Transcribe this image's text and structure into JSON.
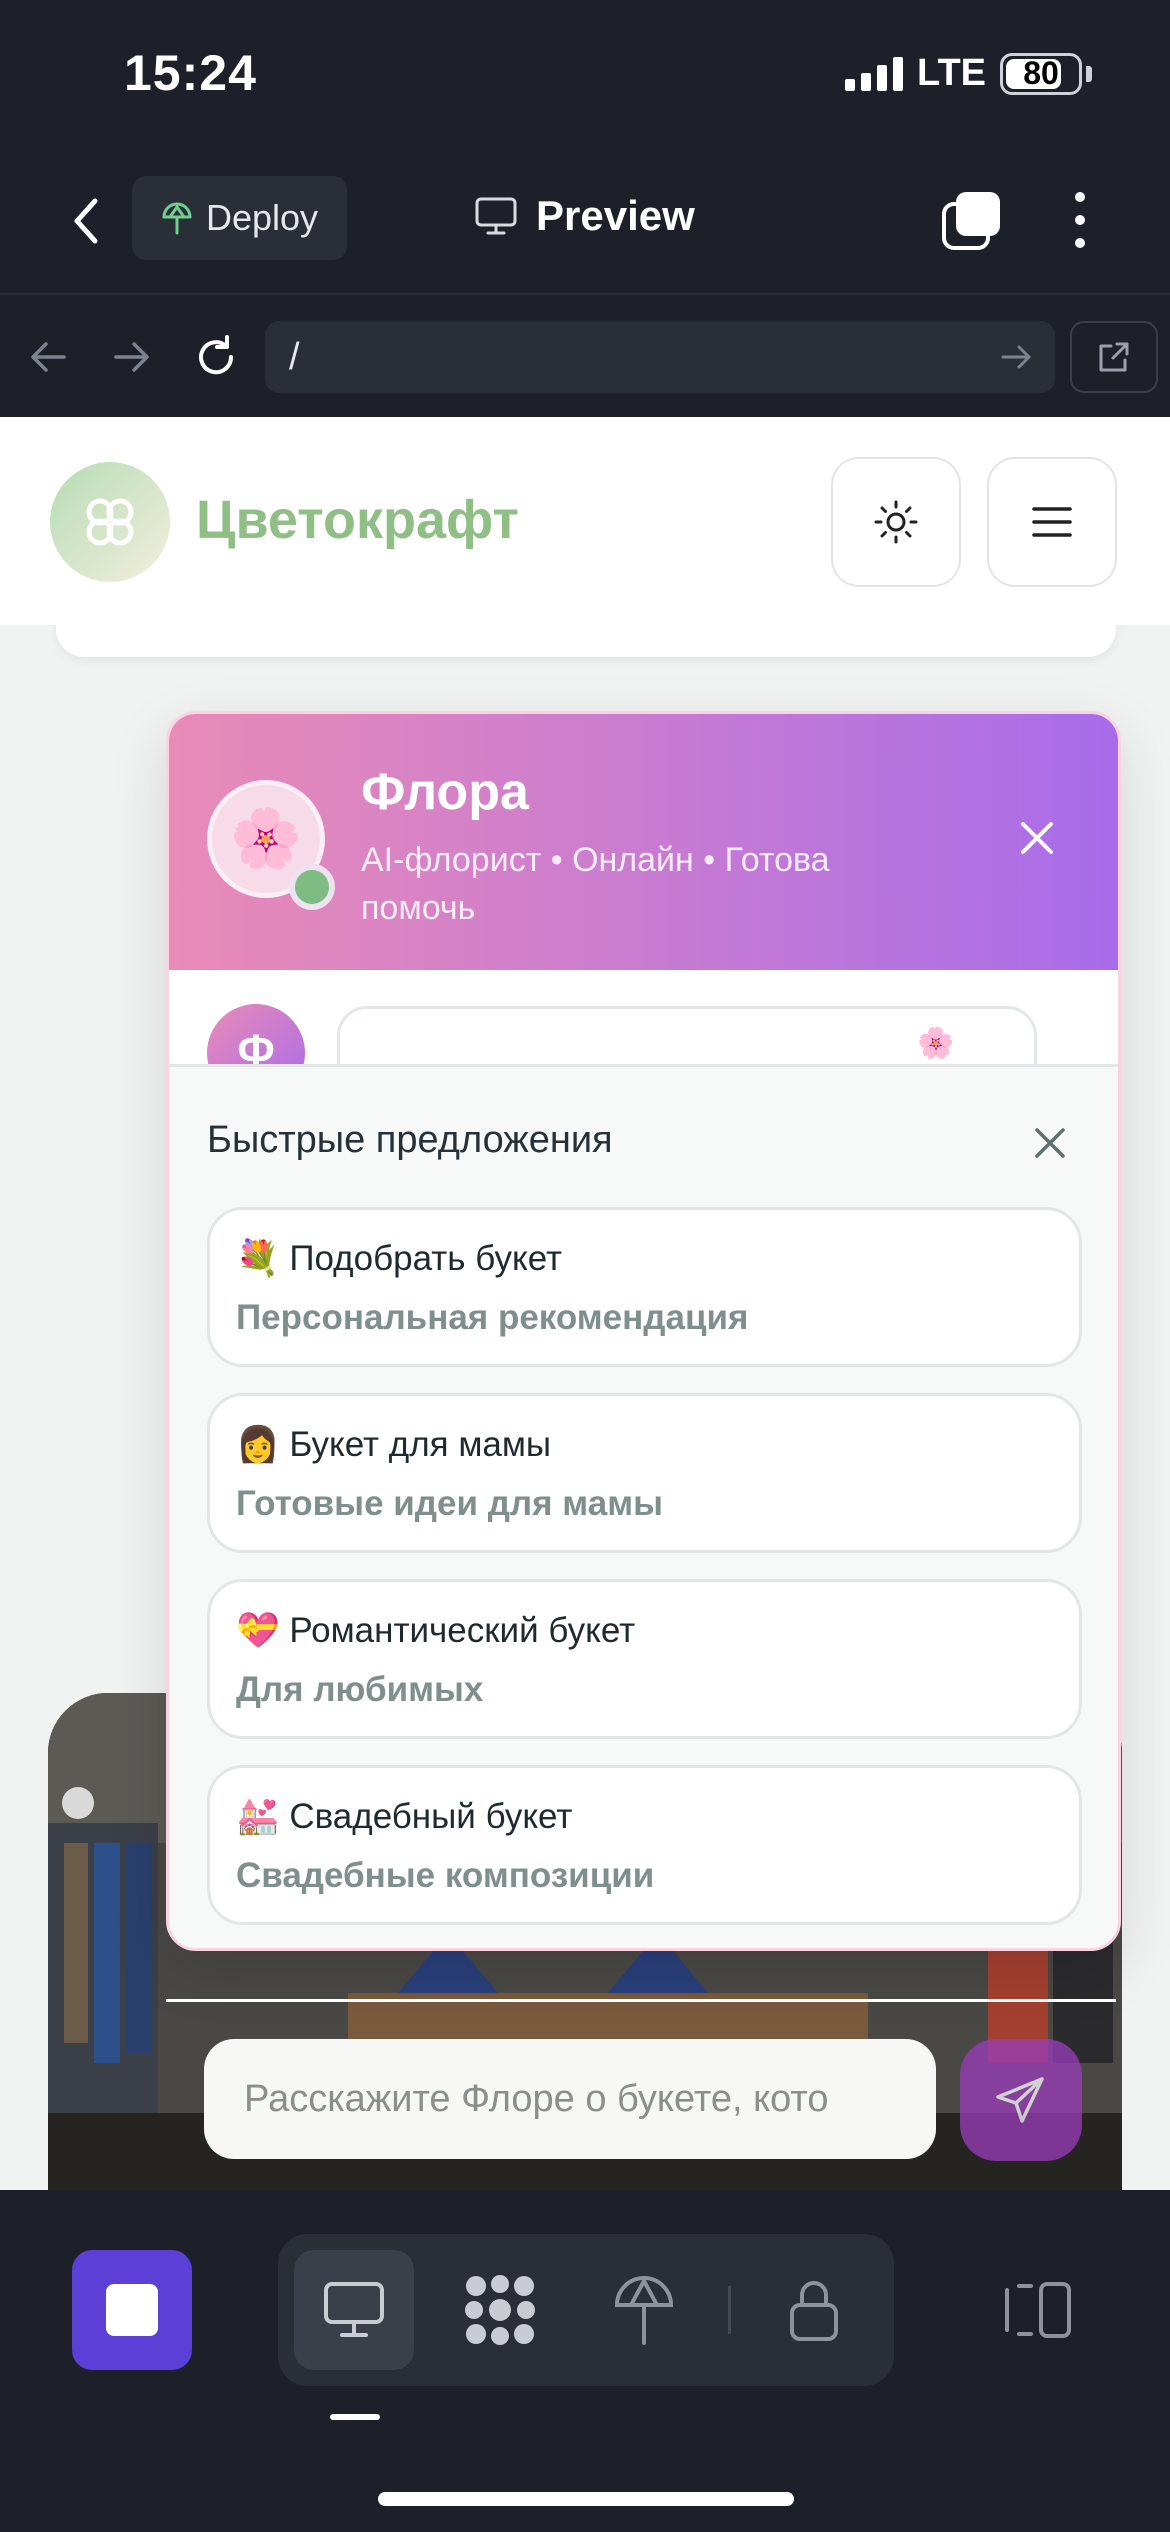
{
  "status_bar": {
    "time": "15:24",
    "network": "LTE",
    "battery": "80",
    "battery_level": 0.8
  },
  "topbar": {
    "deploy_label": "Deploy",
    "preview_label": "Preview"
  },
  "browser": {
    "url": "/"
  },
  "site": {
    "brand": "Цветокрафт",
    "colors": {
      "brand": "#8fbf85",
      "chat_gradient_start": "#e98bb7",
      "chat_gradient_end": "#a86cea"
    }
  },
  "chat": {
    "bot_avatar": "🌸",
    "bot_name": "Флора",
    "bot_status": "AI-флорист • Онлайн • Готова помочь",
    "message_avatar_letter": "Ф",
    "message_flower": "🌸",
    "suggestions": {
      "title": "Быстрые предложения",
      "items": [
        {
          "emoji": "💐",
          "label": "Подобрать букет",
          "description": "Персональная рекомендация"
        },
        {
          "emoji": "👩",
          "label": "Букет для мамы",
          "description": "Готовые идеи для мамы"
        },
        {
          "emoji": "💝",
          "label": "Романтический букет",
          "description": "Для любимых"
        },
        {
          "emoji": "💒",
          "label": "Свадебный букет",
          "description": "Свадебные композиции"
        }
      ]
    },
    "input_placeholder": "Расскажите Флоре о букете, кото"
  },
  "icons": {
    "status": [
      "signal-icon",
      "battery-icon"
    ],
    "topbar": [
      "back-icon",
      "deploy-icon",
      "monitor-icon",
      "tabs-icon",
      "more-icon"
    ],
    "browser": [
      "arrow-left-icon",
      "arrow-right-icon",
      "reload-icon",
      "go-icon",
      "external-link-icon"
    ],
    "toolbar": [
      "stop-icon",
      "monitor-icon",
      "app-grid-icon",
      "deploy-icon",
      "lock-icon",
      "layout-icon"
    ]
  }
}
